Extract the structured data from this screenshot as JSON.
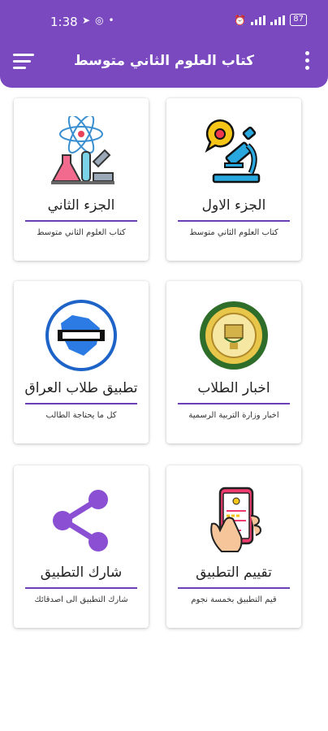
{
  "status_bar": {
    "time": "1:38",
    "battery": "87"
  },
  "app_bar": {
    "title": "كتاب العلوم الثاني متوسط"
  },
  "colors": {
    "accent": "#7a48bf",
    "divider": "#6b3fb5"
  },
  "cards": [
    {
      "title": "الجزء الاول",
      "subtitle": "كتاب العلوم الثاني متوسط",
      "icon": "microscope-icon"
    },
    {
      "title": "الجزء الثاني",
      "subtitle": "كتاب العلوم الثاني متوسط",
      "icon": "chemistry-lab-icon"
    },
    {
      "title": "اخبار الطلاب",
      "subtitle": "اخبار وزارة التربية الرسمية",
      "icon": "ministry-emblem-icon"
    },
    {
      "title": "تطبيق طلاب العراق",
      "subtitle": "كل ما يحتاجة الطالب",
      "icon": "iraq-students-logo-icon"
    },
    {
      "title": "تقييم التطبيق",
      "subtitle": "قيم التطبيق بخمسة نجوم",
      "icon": "rate-phone-icon"
    },
    {
      "title": "شارك التطبيق",
      "subtitle": "شارك التطبيق الى اصدقائك",
      "icon": "share-icon"
    }
  ]
}
